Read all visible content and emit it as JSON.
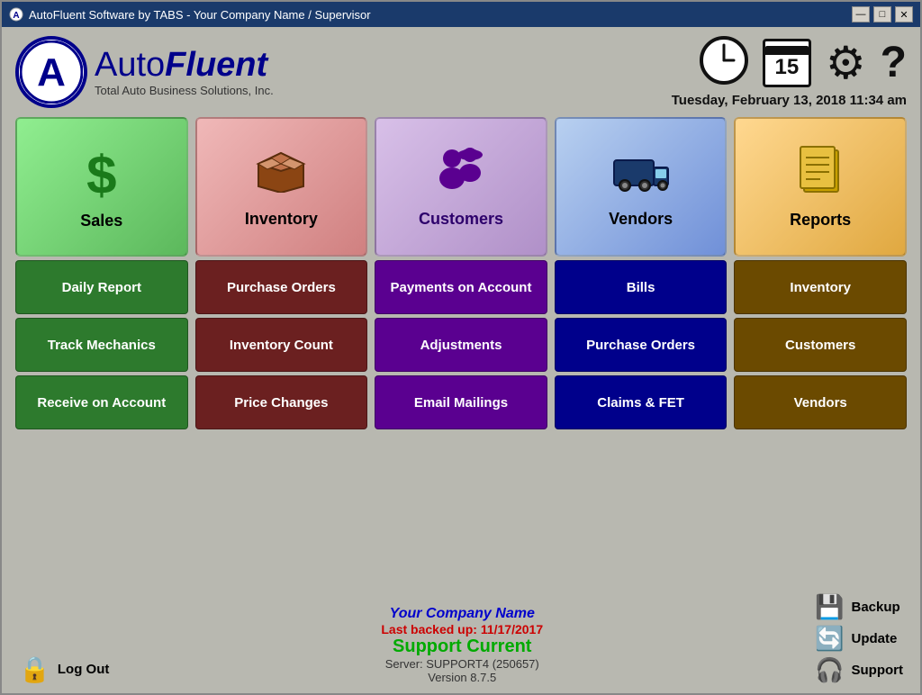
{
  "window": {
    "title": "AutoFluent Software by TABS - Your Company Name / Supervisor",
    "controls": {
      "minimize": "—",
      "restore": "□",
      "close": "✕"
    }
  },
  "header": {
    "logo": {
      "brand_auto": "Auto",
      "brand_fluent": "Fluent",
      "tagline": "Total Auto Business Solutions, Inc."
    },
    "datetime": "Tuesday, February 13, 2018  11:34 am",
    "icons": {
      "clock": "🕐",
      "gear": "⚙",
      "help": "?"
    },
    "calendar_day": "15"
  },
  "columns": [
    {
      "id": "sales",
      "label": "Sales",
      "icon": "$",
      "buttons": [
        "Daily Report",
        "Track Mechanics",
        "Receive on Account"
      ]
    },
    {
      "id": "inventory",
      "label": "Inventory",
      "icon": "📦",
      "buttons": [
        "Purchase Orders",
        "Inventory Count",
        "Price Changes"
      ]
    },
    {
      "id": "customers",
      "label": "Customers",
      "icon": "👥",
      "buttons": [
        "Payments on Account",
        "Adjustments",
        "Email Mailings"
      ]
    },
    {
      "id": "vendors",
      "label": "Vendors",
      "icon": "🚚",
      "buttons": [
        "Bills",
        "Purchase Orders",
        "Claims & FET"
      ]
    },
    {
      "id": "reports",
      "label": "Reports",
      "icon": "📋",
      "buttons": [
        "Inventory",
        "Customers",
        "Vendors"
      ]
    }
  ],
  "bottom": {
    "logout_label": "Log Out",
    "company_name": "Your Company Name",
    "backup_text": "Last backed up: 11/17/2017",
    "support_text": "Support Current",
    "server_text": "Server: SUPPORT4 (250657)",
    "version_text": "Version 8.7.5",
    "util_buttons": [
      "Backup",
      "Update",
      "Support"
    ]
  }
}
